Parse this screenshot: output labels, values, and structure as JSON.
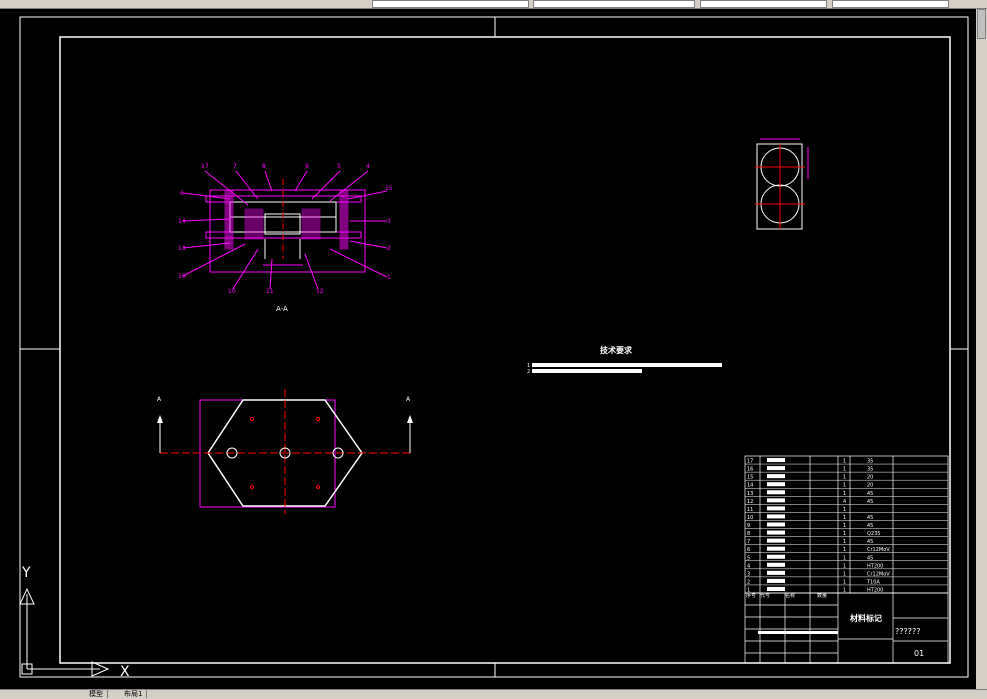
{
  "toolbar": {
    "field1": "",
    "field2": "",
    "field3": ""
  },
  "tabs": [
    "模型",
    "布局1"
  ],
  "drawing": {
    "tech_title": "技术要求",
    "tech_items": [
      "1",
      "2"
    ],
    "section_label": "A-A",
    "title_block": {
      "material_label": "材料标记",
      "drawing_name": "??????",
      "drawing_no": "01",
      "header_cols": [
        "序号",
        "代号",
        "名称",
        "数量",
        "材料"
      ]
    },
    "bom_rows": [
      {
        "no": "17",
        "qty": "1",
        "mat": "35"
      },
      {
        "no": "16",
        "qty": "1",
        "mat": "35"
      },
      {
        "no": "15",
        "qty": "1",
        "mat": "20"
      },
      {
        "no": "14",
        "qty": "1",
        "mat": "20"
      },
      {
        "no": "13",
        "qty": "1",
        "mat": "45"
      },
      {
        "no": "12",
        "qty": "4",
        "mat": "45"
      },
      {
        "no": "11",
        "qty": "1",
        "mat": ""
      },
      {
        "no": "10",
        "qty": "1",
        "mat": "45"
      },
      {
        "no": "9",
        "qty": "1",
        "mat": "45"
      },
      {
        "no": "8",
        "qty": "1",
        "mat": "Q235"
      },
      {
        "no": "7",
        "qty": "1",
        "mat": "45"
      },
      {
        "no": "6",
        "qty": "1",
        "mat": "Cr12MoV"
      },
      {
        "no": "5",
        "qty": "1",
        "mat": "45"
      },
      {
        "no": "4",
        "qty": "1",
        "mat": "HT200"
      },
      {
        "no": "3",
        "qty": "1",
        "mat": "Cr12MoV"
      },
      {
        "no": "2",
        "qty": "1",
        "mat": "T10A"
      },
      {
        "no": "1",
        "qty": "1",
        "mat": "HT200"
      }
    ],
    "part_labels": [
      "17",
      "7",
      "8",
      "9",
      "5",
      "4",
      "6",
      "14",
      "13",
      "15",
      "16",
      "3",
      "1",
      "11",
      "12",
      "10",
      "2"
    ],
    "axis_y": "Y",
    "axis_x": "X",
    "view_marks": [
      "A",
      "A"
    ]
  },
  "colors": {
    "magenta": "#ff00ff",
    "white": "#ffffff",
    "red": "#ff0000",
    "cyan": "#00ffff"
  }
}
